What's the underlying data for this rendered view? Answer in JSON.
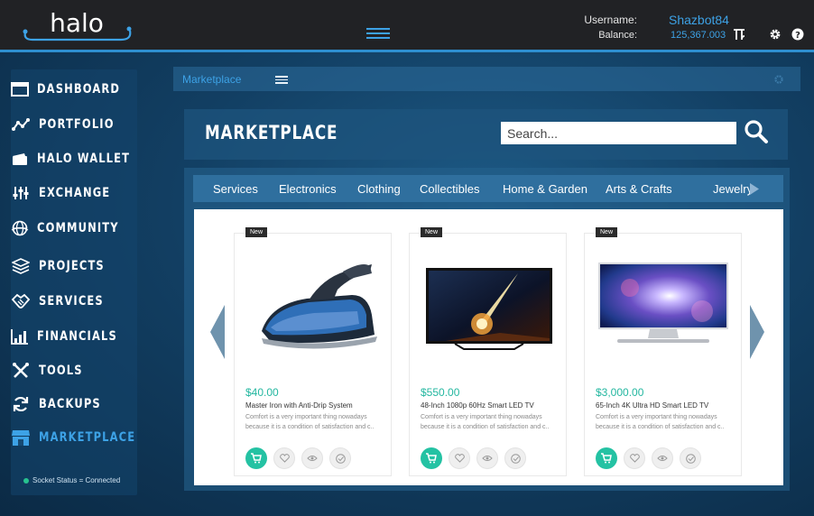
{
  "header": {
    "logo_text": "halo",
    "username_label": "Username:",
    "username": "Shazbot84",
    "balance_label": "Balance:",
    "balance": "125,367.003",
    "icons": [
      "hamburger-icon",
      "halo-coin-icon",
      "gear-icon",
      "help-icon"
    ],
    "accent": "#3da2e6",
    "bar_color": "#212225"
  },
  "sidebar": {
    "items": [
      {
        "label": "DASHBOARD",
        "icon": "dashboard-icon"
      },
      {
        "label": "PORTFOLIO",
        "icon": "portfolio-icon"
      },
      {
        "label": "HALO WALLET",
        "icon": "wallet-icon"
      },
      {
        "label": "EXCHANGE",
        "icon": "exchange-icon"
      },
      {
        "label": "COMMUNITY",
        "icon": "globe-icon"
      },
      {
        "label": "PROJECTS",
        "icon": "layers-icon"
      },
      {
        "label": "SERVICES",
        "icon": "handshake-icon"
      },
      {
        "label": "FINANCIALS",
        "icon": "bar-chart-icon"
      },
      {
        "label": "TOOLS",
        "icon": "tools-icon"
      },
      {
        "label": "BACKUPS",
        "icon": "refresh-icon"
      },
      {
        "label": "MARKETPLACE",
        "icon": "store-icon",
        "active": true
      }
    ],
    "socket_status": "Socket Status = Connected",
    "socket_color": "#27c28f"
  },
  "main": {
    "breadcrumb": "Marketplace",
    "title": "MARKETPLACE",
    "search": {
      "placeholder": "Search..."
    },
    "categories": [
      "Services",
      "Electronics",
      "Clothing",
      "Collectibles",
      "Home & Garden",
      "Arts & Crafts",
      "Jewelry"
    ],
    "products": [
      {
        "badge": "New",
        "price": "$40.00",
        "name": "Master Iron with Anti-Drip System",
        "description": "Comfort is a very important thing nowadays because it is a condition of satisfaction and c..",
        "image": "steam-iron"
      },
      {
        "badge": "New",
        "price": "$550.00",
        "name": "48-Inch 1080p 60Hz Smart LED TV",
        "description": "Comfort is a very important thing nowadays because it is a condition of satisfaction and c..",
        "image": "led-tv-meteor"
      },
      {
        "badge": "New",
        "price": "$3,000.00",
        "name": "65-Inch 4K Ultra HD Smart LED TV",
        "description": "Comfort is a very important thing nowadays because it is a condition of satisfaction and c..",
        "image": "led-tv-galaxy"
      }
    ],
    "price_color": "#24b7a0",
    "card_actions": [
      "cart-icon",
      "heart-icon",
      "eye-icon",
      "check-icon"
    ]
  }
}
